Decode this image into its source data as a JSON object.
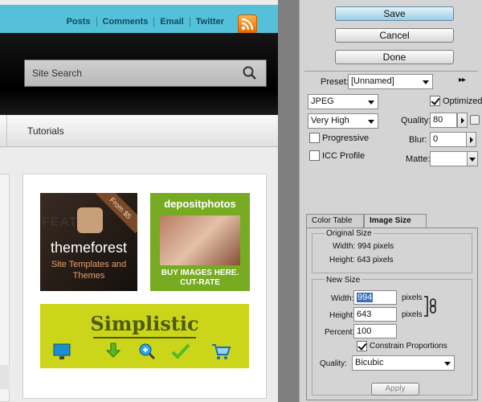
{
  "preview": {
    "top_links": [
      "Posts",
      "Comments",
      "Email",
      "Twitter"
    ],
    "search_placeholder": "Site Search",
    "nav_item": "Tutorials",
    "ads": {
      "themeforest": {
        "badge": "From $5",
        "brand": "themeforest",
        "tagline": "Site Templates and Themes"
      },
      "depositphotos": {
        "brand": "depositphotos",
        "line1": "BUY IMAGES HERE.",
        "line2": "CUT-RATE"
      },
      "simplistic": {
        "title": "Simplistic"
      }
    }
  },
  "panel": {
    "buttons": {
      "save": "Save",
      "cancel": "Cancel",
      "done": "Done"
    },
    "preset_label": "Preset:",
    "preset_value": "[Unnamed]",
    "format_value": "JPEG",
    "optimized_label": "Optimized",
    "optimized_checked": true,
    "quality_preset_value": "Very High",
    "quality_label": "Quality:",
    "quality_value": "80",
    "progressive_label": "Progressive",
    "blur_label": "Blur:",
    "blur_value": "0",
    "icc_label": "ICC Profile",
    "matte_label": "Matte:",
    "tabs": [
      "Color Table",
      "Image Size"
    ],
    "active_tab": "Image Size",
    "original_size": {
      "title": "Original Size",
      "width_text": "Width: 994 pixels",
      "height_text": "Height: 643 pixels"
    },
    "new_size": {
      "title": "New Size",
      "width_label": "Width:",
      "width_value": "994",
      "height_label": "Height:",
      "height_value": "643",
      "unit": "pixels",
      "percent_label": "Percent:",
      "percent_value": "100",
      "constrain_label": "Constrain Proportions",
      "constrain_checked": true,
      "quality_label": "Quality:",
      "quality_value": "Bicubic",
      "apply_label": "Apply"
    }
  },
  "icons": [
    "rss-icon",
    "search-icon",
    "link-icon",
    "dropdown-arrow-icon",
    "spin-arrow-icon",
    "settings-menu-icon"
  ]
}
